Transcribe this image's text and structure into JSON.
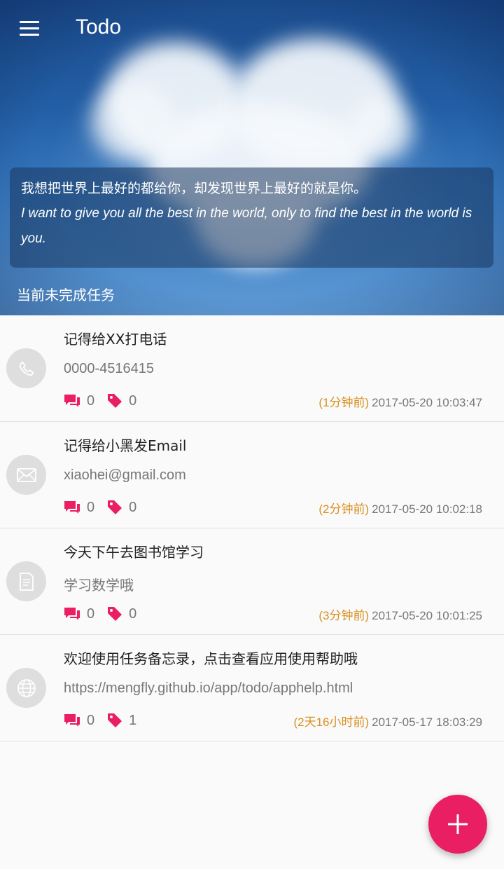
{
  "app": {
    "title": "Todo"
  },
  "header": {
    "quote_zh": "我想把世界上最好的都给你，却发现世界上最好的就是你。",
    "quote_en": "I want to give you all the best in the world, only to find the best in the world is you.",
    "section_title": "当前未完成任务"
  },
  "colors": {
    "accent": "#e91e63",
    "time_ago": "#d8901f",
    "meta_icon": "#e91e63"
  },
  "tasks": [
    {
      "icon": "phone-icon",
      "title": "记得给XX打电话",
      "subtitle": "0000-4516415",
      "comments": "0",
      "tags": "0",
      "ago": "(1分钟前)",
      "datetime": "2017-05-20 10:03:47"
    },
    {
      "icon": "email-icon",
      "title": "记得给小黑发Email",
      "subtitle": "xiaohei@gmail.com",
      "comments": "0",
      "tags": "0",
      "ago": "(2分钟前)",
      "datetime": "2017-05-20 10:02:18"
    },
    {
      "icon": "document-icon",
      "title": "今天下午去图书馆学习",
      "subtitle": "学习数学哦",
      "comments": "0",
      "tags": "0",
      "ago": "(3分钟前)",
      "datetime": "2017-05-20 10:01:25"
    },
    {
      "icon": "globe-icon",
      "title": "欢迎使用任务备忘录，点击查看应用使用帮助哦",
      "subtitle": "https://mengfly.github.io/app/todo/apphelp.html",
      "comments": "0",
      "tags": "1",
      "ago": "(2天16小时前)",
      "datetime": "2017-05-17 18:03:29"
    }
  ]
}
